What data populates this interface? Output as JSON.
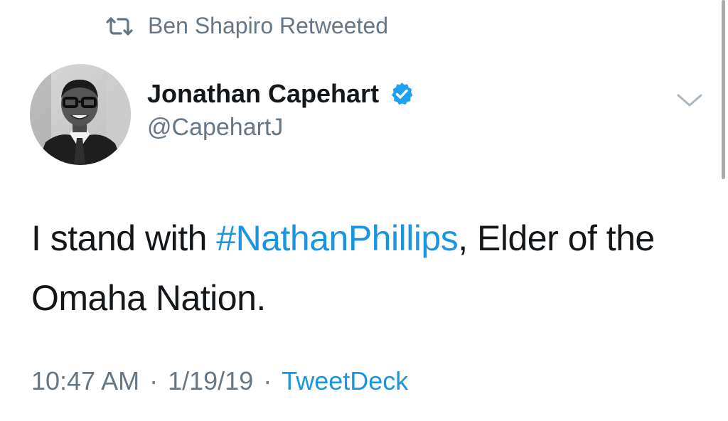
{
  "retweet_context": {
    "label": "Ben Shapiro Retweeted",
    "icon": "retweet-icon"
  },
  "author": {
    "display_name": "Jonathan Capehart",
    "handle": "@CapehartJ",
    "verified": true,
    "verified_icon": "verified-badge-icon",
    "avatar": "avatar-photo"
  },
  "tweet": {
    "text_before": "I stand with ",
    "hashtag": "#NathanPhillips",
    "text_after": ", Elder of the Omaha Nation."
  },
  "meta": {
    "time": "10:47 AM",
    "separator": "·",
    "date": "1/19/19",
    "source": "TweetDeck"
  },
  "colors": {
    "link": "#1b95e0",
    "secondary_text": "#657786",
    "primary_text": "#14171a",
    "verified": "#1da1f2"
  },
  "icons": {
    "more_menu": "chevron-down-icon"
  }
}
